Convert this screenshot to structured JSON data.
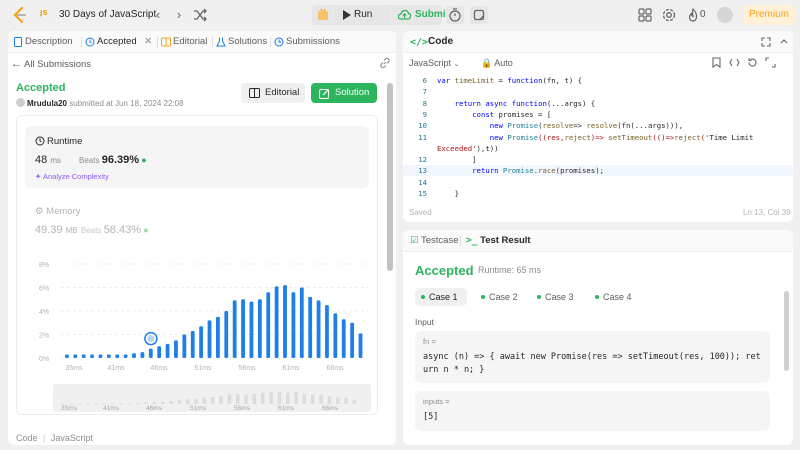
{
  "topbar": {
    "lang_badge": "JS",
    "title": "30 Days of JavaScript",
    "run_label": "Run",
    "submit_label": "Submit",
    "fire_count": "0",
    "premium_label": "Premium"
  },
  "tabs": [
    {
      "label": "Description",
      "icon": "description-icon"
    },
    {
      "label": "Accepted",
      "icon": "history-icon"
    },
    {
      "label": "Editorial",
      "icon": "book-icon"
    },
    {
      "label": "Solutions",
      "icon": "flask-icon"
    },
    {
      "label": "Submissions",
      "icon": "clock-icon"
    }
  ],
  "submission": {
    "back_label": "All Submissions",
    "status": "Accepted",
    "user": "Mrudula20",
    "submitted_text": "submitted at Jun 18, 2024 22:08",
    "editorial_label": "Editorial",
    "solution_label": "Solution"
  },
  "runtime": {
    "label": "Runtime",
    "value": "48",
    "unit": "ms",
    "beats_label": "Beats",
    "beats_pct": "96.39%",
    "analyze_label": "Analyze Complexity"
  },
  "memory": {
    "label": "Memory",
    "value": "49.39",
    "unit": "MB",
    "beats_label": "Beats",
    "beats_pct": "58.43%"
  },
  "chart_data": {
    "type": "bar",
    "y_ticks": [
      "8%",
      "6%",
      "4%",
      "2%",
      "0%"
    ],
    "ylim": [
      0,
      8
    ],
    "x_ticks": [
      "35ms",
      "41ms",
      "46ms",
      "51ms",
      "56ms",
      "61ms",
      "66ms"
    ],
    "values": [
      0.3,
      0.3,
      0.3,
      0.3,
      0.3,
      0.3,
      0.3,
      0.3,
      0.4,
      0.5,
      0.8,
      1.0,
      1.2,
      1.5,
      2.0,
      2.3,
      2.7,
      3.2,
      3.5,
      4.0,
      4.9,
      5.0,
      4.8,
      5.0,
      5.6,
      6.1,
      6.2,
      5.6,
      6.0,
      5.2,
      4.9,
      4.5,
      3.8,
      3.3,
      3.0,
      2.1
    ],
    "selected_index": 10,
    "minimap_ticks": [
      "35ms",
      "41ms",
      "46ms",
      "51ms",
      "56ms",
      "61ms",
      "66ms"
    ]
  },
  "footer": {
    "code_label": "Code",
    "lang_label": "JavaScript"
  },
  "code": {
    "title": "Code",
    "language": "JavaScript",
    "mode": "Auto",
    "lines": [
      {
        "n": "6",
        "t": "var timeLimit = function(fn, t) {"
      },
      {
        "n": "7",
        "t": ""
      },
      {
        "n": "8",
        "t": "    return async function(...args) {"
      },
      {
        "n": "9",
        "t": "        const promises = ["
      },
      {
        "n": "10",
        "t": "            new Promise(resolve=> resolve(fn(...args))),"
      },
      {
        "n": "11",
        "t": "            new Promise((res,reject)=> setTimeout(()=>reject('Time Limit"
      },
      {
        "n": "",
        "t": "Exceeded'),t))"
      },
      {
        "n": "12",
        "t": "        ]"
      },
      {
        "n": "13",
        "t": "        return Promise.race(promises);"
      },
      {
        "n": "14",
        "t": ""
      },
      {
        "n": "15",
        "t": "    }"
      }
    ],
    "saved": "Saved",
    "position": "Ln 13, Col 39"
  },
  "test": {
    "tab_testcase": "Testcase",
    "tab_result": "Test Result",
    "status": "Accepted",
    "runtime": "Runtime: 65 ms",
    "cases": [
      "Case 1",
      "Case 2",
      "Case 3",
      "Case 4"
    ],
    "input_label": "Input",
    "vars": [
      {
        "name": "fn =",
        "value": "async (n) => { await new Promise(res => setTimeout(res, 100)); return n * n; }"
      },
      {
        "name": "inputs =",
        "value": "[5]"
      }
    ]
  },
  "colors": {
    "accent_green": "#2db55d",
    "bar_blue": "#1e7fe6",
    "premium_orange": "#ffa116"
  }
}
